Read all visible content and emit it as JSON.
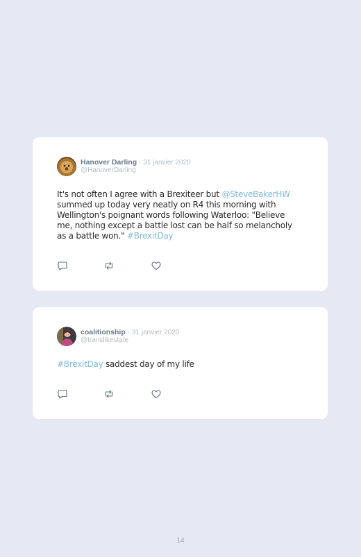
{
  "tweets": [
    {
      "author": {
        "name": "Hanover Darling",
        "separator": "·",
        "date": "31 janvier 2020",
        "handle": "@HanoverDarling",
        "avatar": "lion-avatar"
      },
      "text_parts": {
        "p1": "It's not often I agree with a Brexiteer but ",
        "mention": "@SteveBakerHW",
        "p2": " summed up today very neatly on R4 this morning with Wellington's poignant words following Waterloo: \"Believe me, nothing except a battle lost can be half so melancholy as a battle won.\" ",
        "hashtag": "#BrexitDay"
      },
      "actions": [
        "reply-icon",
        "retweet-icon",
        "like-icon"
      ]
    },
    {
      "author": {
        "name": "coalitionship",
        "separator": "·",
        "date": "31 janvier 2020",
        "handle": "@translikestate",
        "avatar": "person-avatar"
      },
      "text_parts": {
        "hashtag": "#BrexitDay",
        "p1": " saddest day of my life"
      },
      "actions": [
        "reply-icon",
        "retweet-icon",
        "like-icon"
      ]
    }
  ],
  "page_number": "14",
  "colors": {
    "background": "#e6e9f4",
    "card": "#ffffff",
    "link": "#7fb8dc",
    "name": "#66798a",
    "muted": "#b3bac4"
  }
}
